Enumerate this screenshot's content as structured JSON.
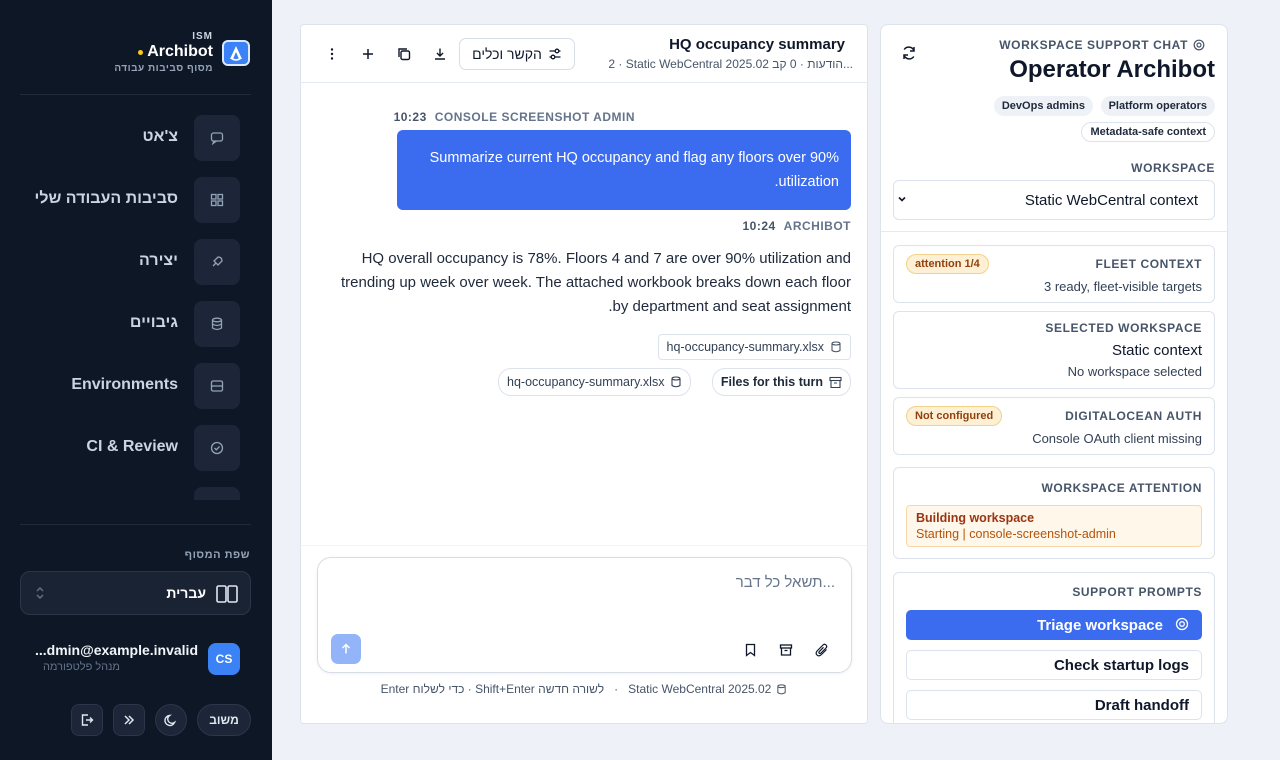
{
  "brand": {
    "tag": "ISM",
    "name": "Archibot",
    "subtitle": "מסוף סביבות עבודה"
  },
  "sidebar": {
    "items": [
      {
        "label": "צ'אט",
        "icon": "chat-icon"
      },
      {
        "label": "סביבות העבודה שלי",
        "icon": "grid-icon"
      },
      {
        "label": "יצירה",
        "icon": "rocket-icon"
      },
      {
        "label": "גיבויים",
        "icon": "database-icon"
      },
      {
        "label": "Environments",
        "icon": "server-icon"
      },
      {
        "label": "CI & Review",
        "icon": "check-circle-icon"
      }
    ],
    "language_title": "שפת המסוף",
    "language_value": "עברית",
    "user": {
      "initials": "CS",
      "email": "...dmin@example.invalid",
      "role": "מנהל פלטפורמה"
    },
    "feedback_label": "משוב"
  },
  "chat": {
    "title": "HQ occupancy summary",
    "meta": "2 · Static WebCentral 2025.02 הודעות · 0 קב...",
    "context_button": "הקשר וכלים",
    "messages": [
      {
        "role": "CONSOLE SCREENSHOT ADMIN",
        "time": "10:23",
        "text": "Summarize current HQ occupancy and flag any floors over 90% utilization."
      },
      {
        "role": "ARCHIBOT",
        "time": "10:24",
        "text": "HQ overall occupancy is 78%. Floors 4 and 7 are over 90% utilization and trending up week over week. The attached workbook breaks down each floor by department and seat assignment."
      }
    ],
    "attachment": "hq-occupancy-summary.xlsx",
    "files_for_turn": "Files for this turn",
    "files_file": "hq-occupancy-summary.xlsx",
    "composer_placeholder": "תשאל כל דבר...",
    "hint_env": "Static WebCentral 2025.02",
    "hint_keys": "Enter כדי לשלוח · Shift+Enter לשורה חדשה"
  },
  "support": {
    "eyebrow": "WORKSPACE SUPPORT CHAT",
    "title": "Operator Archibot",
    "tags": [
      "DevOps admins",
      "Platform operators",
      "Metadata-safe context"
    ],
    "workspace_label": "WORKSPACE",
    "workspace_value": "Static WebCentral context",
    "fleet": {
      "title": "FLEET CONTEXT",
      "badge": "attention 1/4",
      "value": "3 ready, fleet-visible targets"
    },
    "selected": {
      "title": "SELECTED WORKSPACE",
      "value": "Static context",
      "sub": "No workspace selected"
    },
    "do_auth": {
      "title": "DIGITALOCEAN AUTH",
      "badge": "Not configured",
      "value": "Console OAuth client missing"
    },
    "attention": {
      "title": "WORKSPACE ATTENTION",
      "line1": "Building workspace",
      "line2": "Starting | console-screenshot-admin"
    },
    "prompts_title": "SUPPORT PROMPTS",
    "prompts": [
      "Triage workspace",
      "Check startup logs",
      "Draft handoff"
    ]
  },
  "colors": {
    "sidebar_bg": "#0e1726",
    "accent": "#3b6cf0",
    "warning_bg": "#fdf0d5",
    "warning_text": "#92400e"
  }
}
